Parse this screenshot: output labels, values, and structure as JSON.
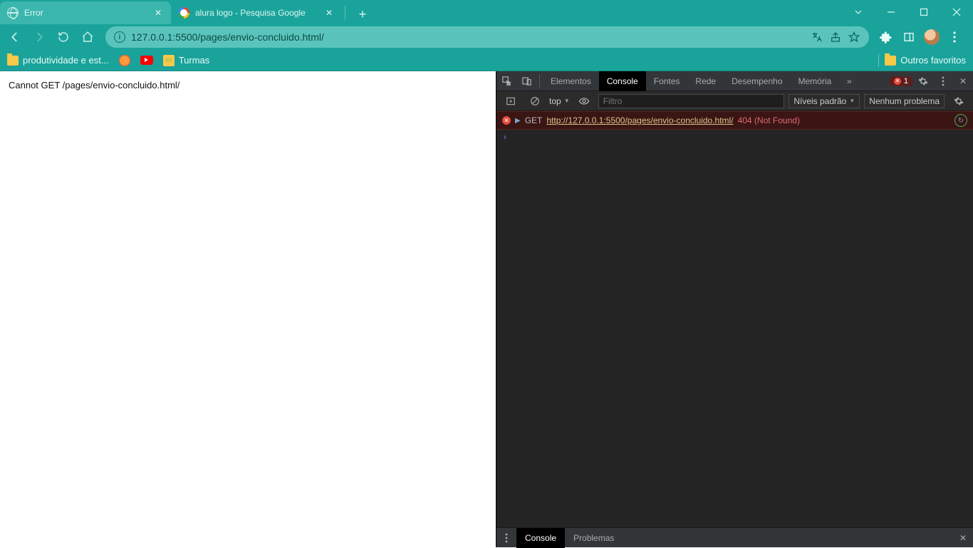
{
  "tabs": [
    {
      "title": "Error",
      "active": true
    },
    {
      "title": "alura logo - Pesquisa Google",
      "active": false
    }
  ],
  "url": "127.0.0.1:5500/pages/envio-concluido.html/",
  "bookmarks": {
    "items": [
      {
        "label": "produtividade e est..."
      },
      {
        "label": ""
      },
      {
        "label": ""
      },
      {
        "label": "Turmas"
      }
    ],
    "other": "Outros favoritos"
  },
  "page_body": "Cannot GET /pages/envio-concluido.html/",
  "devtools": {
    "tabs": {
      "elements": "Elementos",
      "console": "Console",
      "sources": "Fontes",
      "network": "Rede",
      "performance": "Desempenho",
      "memory": "Memória"
    },
    "error_count": "1",
    "console_toolbar": {
      "context": "top",
      "filter_placeholder": "Filtro",
      "levels": "Níveis padrão",
      "issues": "Nenhum problema"
    },
    "console_msg": {
      "method": "GET",
      "url": "http://127.0.0.1:5500/pages/envio-concluido.html/",
      "status": "404 (Not Found)"
    },
    "drawer": {
      "console": "Console",
      "problems": "Problemas"
    }
  }
}
